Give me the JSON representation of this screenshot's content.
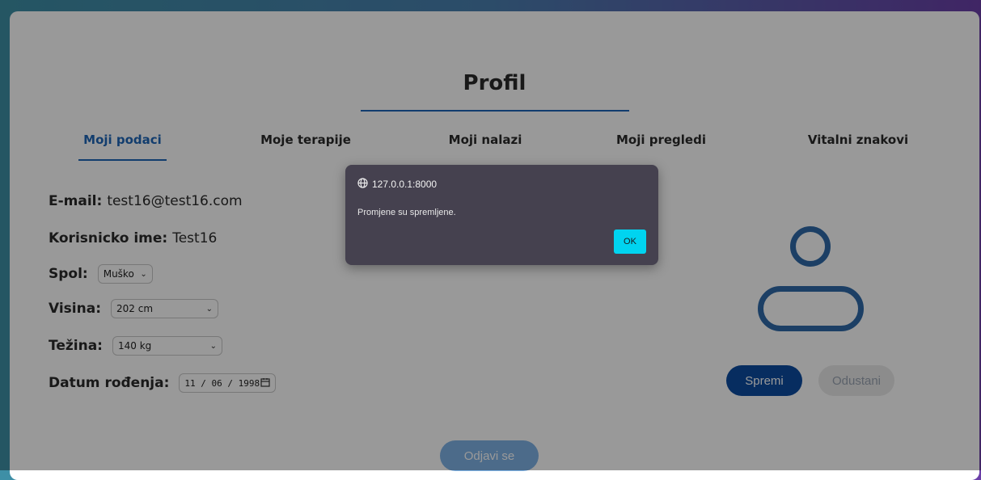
{
  "page": {
    "title": "Profil"
  },
  "tabs": [
    {
      "label": "Moji podaci",
      "active": true
    },
    {
      "label": "Moje terapije"
    },
    {
      "label": "Moji nalazi"
    },
    {
      "label": "Moji pregledi"
    },
    {
      "label": "Vitalni znakovi"
    }
  ],
  "profile": {
    "email_label": "E-mail:",
    "email_value": "test16@test16.com",
    "username_label": "Korisnicko ime:",
    "username_value": "Test16",
    "gender_label": "Spol:",
    "gender_value": "Muško",
    "height_label": "Visina:",
    "height_value": "202 cm",
    "weight_label": "Težina:",
    "weight_value": "140 kg",
    "dob_label": "Datum rođenja:",
    "dob_value": "11 / 06 / 1998"
  },
  "actions": {
    "save": "Spremi",
    "cancel": "Odustani",
    "logout": "Odjavi se"
  },
  "dialog": {
    "origin": "127.0.0.1:8000",
    "message": "Promjene su spremljene.",
    "ok": "OK"
  },
  "colors": {
    "accent": "#1f67b8",
    "save_button": "#0d4ca0",
    "ok_button": "#00d4f0",
    "dialog_bg": "#45414f"
  }
}
